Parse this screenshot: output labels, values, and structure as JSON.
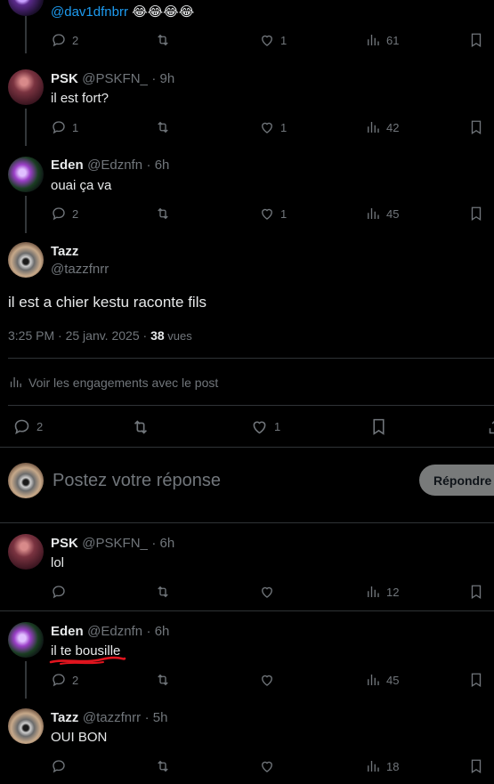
{
  "top_tweet": {
    "mention": "@dav1dfnbrr",
    "emoji": "😂😂😂😂",
    "replies": "2",
    "likes": "1",
    "views": "61"
  },
  "tweet_psk1": {
    "name": "PSK",
    "handle": "@PSKFN_",
    "time": "· 9h",
    "text": "il est fort?",
    "replies": "1",
    "likes": "1",
    "views": "42"
  },
  "tweet_eden1": {
    "name": "Eden",
    "handle": "@Edznfn",
    "time": "· 6h",
    "text": "ouai ça va",
    "replies": "2",
    "likes": "1",
    "views": "45"
  },
  "main_tweet": {
    "name": "Tazz",
    "handle": "@tazzfnrr",
    "text": "il est a chier kestu raconte fils",
    "date": "3:25 PM · 25 janv. 2025 · ",
    "views_count": "38",
    "views_label": " vues",
    "engagements": "Voir les engagements avec le post",
    "replies": "2",
    "likes": "1"
  },
  "composer": {
    "placeholder": "Postez votre réponse",
    "button": "Répondre"
  },
  "tweet_psk2": {
    "name": "PSK",
    "handle": "@PSKFN_",
    "time": "· 6h",
    "text": "lol",
    "views": "12"
  },
  "tweet_eden2": {
    "name": "Eden",
    "handle": "@Edznfn",
    "time": "· 6h",
    "text": "il te bousille",
    "replies": "2",
    "views": "45"
  },
  "tweet_tazz2": {
    "name": "Tazz",
    "handle": "@tazzfnrr",
    "time": "· 5h",
    "text": "OUI BON",
    "views": "18"
  },
  "colors": {
    "background": "#000000",
    "text": "#e7e9ea",
    "muted": "#71767b",
    "link": "#1d9bf0",
    "divider": "#2f3336",
    "underline_annotation": "#e0141e"
  },
  "icons": [
    "reply-icon",
    "retweet-icon",
    "like-icon",
    "views-icon",
    "bookmark-icon",
    "share-icon"
  ]
}
